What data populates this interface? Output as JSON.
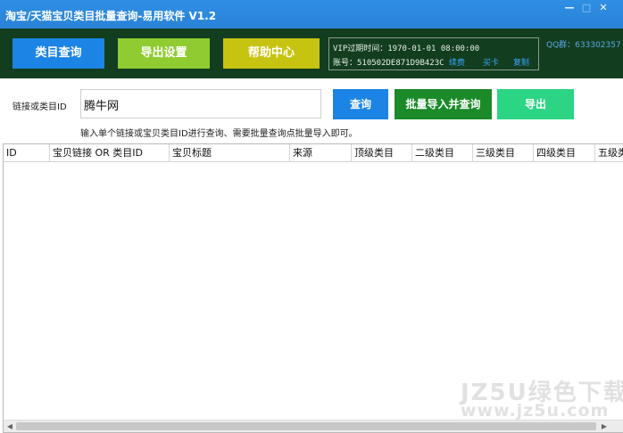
{
  "window": {
    "title": "淘宝/天猫宝贝类目批量查询-易用软件 V1.2",
    "minimize_symbol": "—",
    "maximize_symbol": "□",
    "close_symbol": "✕"
  },
  "nav": {
    "category_query": "类目查询",
    "export_settings": "导出设置",
    "help_center": "帮助中心"
  },
  "account": {
    "vip_expiry": "VIP过期时间：1970-01-01 08:00:00",
    "account_id": "账号：510502DE871D9B423C",
    "renew": "续费",
    "buy_card": "买卡",
    "copy": "复制"
  },
  "qq_group": "QQ群：633302357",
  "form": {
    "label": "链接或类目ID",
    "input_value": "腾牛网",
    "search_button": "查询",
    "batch_import_button": "批量导入并查询",
    "export_button": "导出",
    "hint": "输入单个链接或宝贝类目ID进行查询、需要批量查询点批量导入即可。"
  },
  "table": {
    "columns": [
      "ID",
      "宝贝链接 OR 类目ID",
      "宝贝标题",
      "来源",
      "顶级类目",
      "二级类目",
      "三级类目",
      "四级类目",
      "五级类"
    ],
    "rows": []
  },
  "scrollbar": {
    "left_arrow": "◀",
    "right_arrow": "▶"
  },
  "watermark": {
    "line1": "JZ5U绿色下载",
    "line2": "www.jz5u.com"
  },
  "colors": {
    "titlebar": "#2a82d8",
    "topbar": "#123d1f",
    "primary_blue": "#1c84e5",
    "green": "#1b8a29",
    "light_green": "#2bd584",
    "lime": "#90cc31",
    "olive": "#c7c411",
    "link_blue": "#39a1ff"
  }
}
